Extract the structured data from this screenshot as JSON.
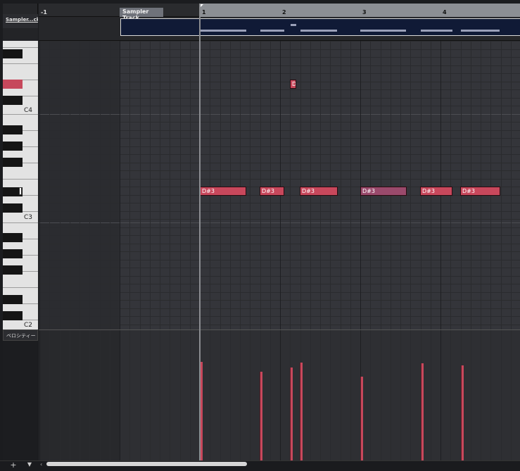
{
  "left": {
    "track_short_name": "Sampler...ck",
    "velocity_label": "ベロシティー"
  },
  "ruler": {
    "bars": [
      "-1",
      "1",
      "2",
      "3",
      "4"
    ]
  },
  "part": {
    "label": "Sampler Track"
  },
  "keyboard": {
    "octave_labels": [
      "C4",
      "C3",
      "C2"
    ]
  },
  "notes": [
    {
      "pitch": "D",
      "bar": "2",
      "text": "D"
    },
    {
      "pitch": "D#3",
      "text": "D#3"
    },
    {
      "pitch": "D#3",
      "text": "D#3"
    },
    {
      "pitch": "D#3",
      "text": "D#3"
    },
    {
      "pitch": "D#3",
      "text": "D#3",
      "selected": true
    },
    {
      "pitch": "D#3",
      "text": "D#3"
    },
    {
      "pitch": "D#3",
      "text": "D#3"
    }
  ],
  "bottom": {
    "add_symbol": "+",
    "menu_symbol": "▼",
    "scroll_left_symbol": "‹"
  },
  "colors": {
    "note": "#c8485c",
    "selected_note": "#9a4a6c",
    "part_bg": "#101a36"
  }
}
